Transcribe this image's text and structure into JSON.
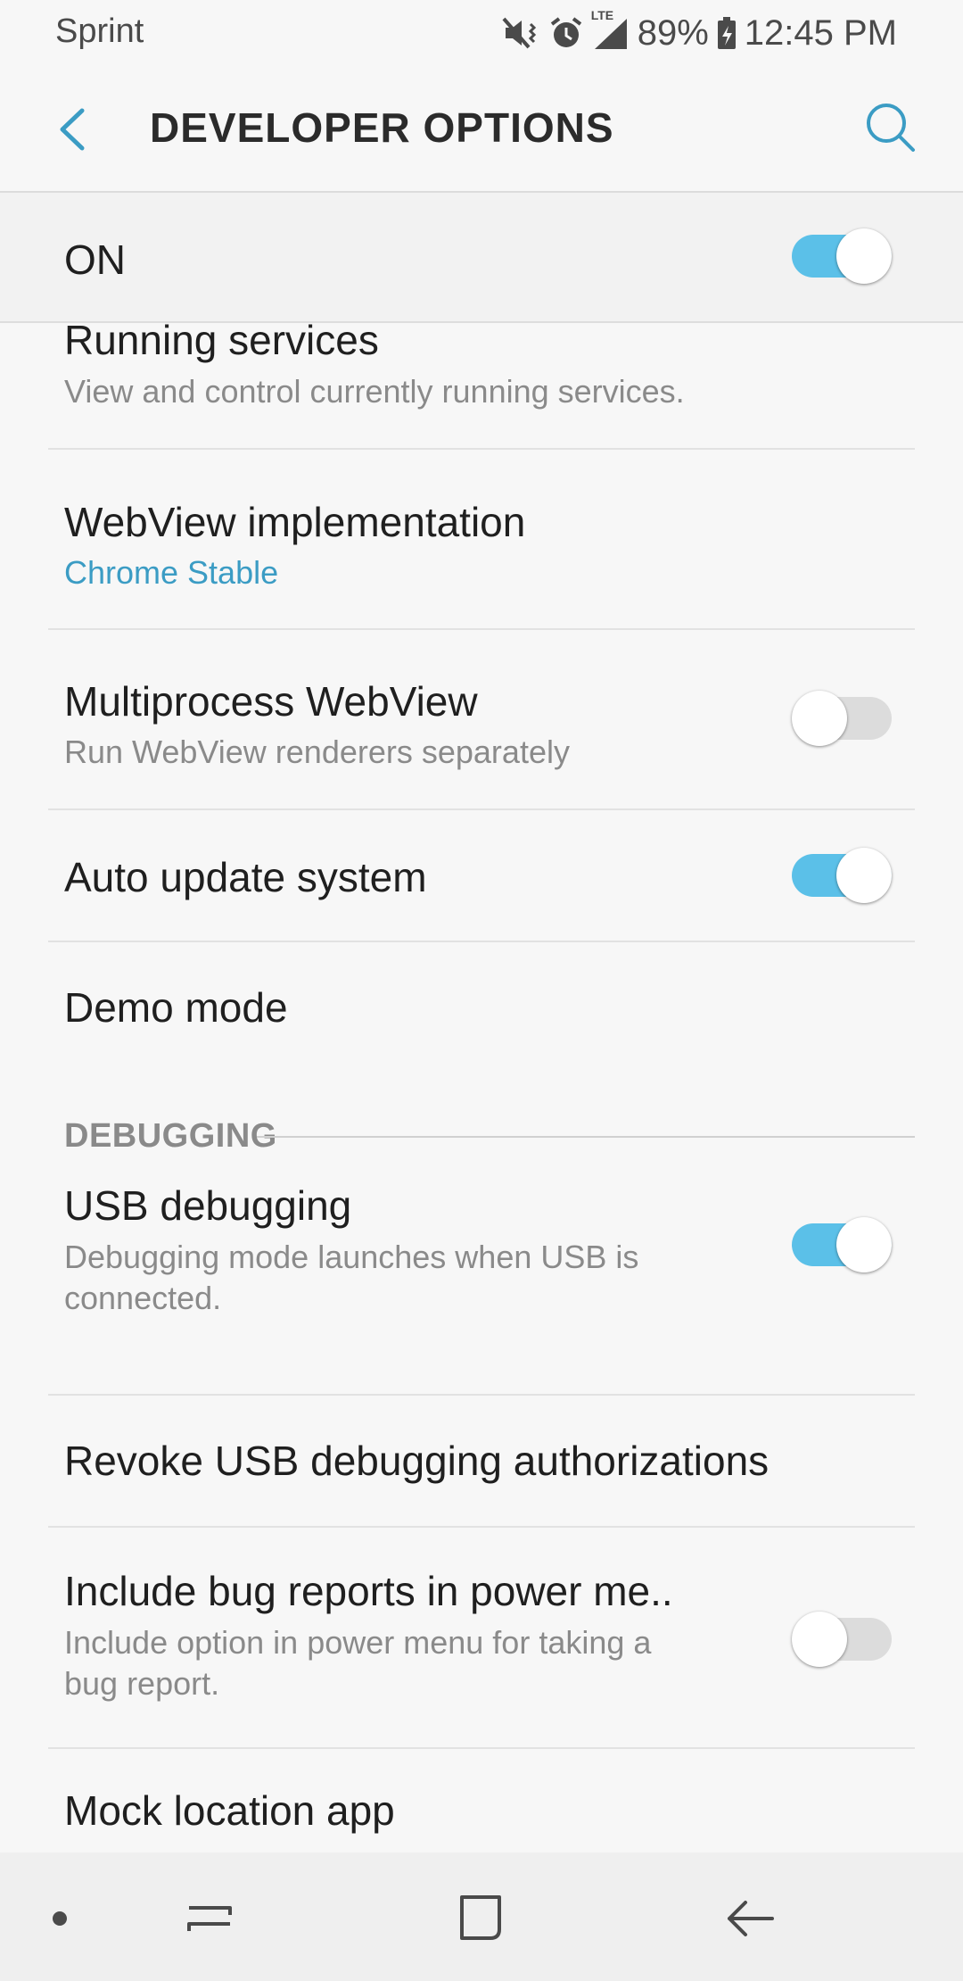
{
  "status_bar": {
    "carrier": "Sprint",
    "battery": "89%",
    "time": "12:45 PM",
    "network_label": "LTE",
    "icons": [
      "mute-vibrate-icon",
      "alarm-icon",
      "signal-icon",
      "battery-charging-icon"
    ]
  },
  "appbar": {
    "title": "DEVELOPER OPTIONS",
    "back_icon": "back-arrow-icon",
    "search_icon": "search-icon"
  },
  "master_switch": {
    "label": "ON",
    "on": true
  },
  "items": [
    {
      "title": "Running services",
      "subtitle": "View and control currently running services."
    },
    {
      "title": "WebView implementation",
      "subtitle": "Chrome Stable"
    },
    {
      "title": "Multiprocess WebView",
      "subtitle": "Run WebView renderers separately",
      "toggle": false
    },
    {
      "title": "Auto update system",
      "toggle": true
    },
    {
      "title": "Demo mode"
    }
  ],
  "debugging": {
    "header": "DEBUGGING",
    "items": [
      {
        "title": "USB debugging",
        "subtitle_line1": "Debugging mode launches when USB is",
        "subtitle_line2": "connected.",
        "toggle": true
      },
      {
        "title": "Revoke USB debugging authorizations"
      },
      {
        "title": "Include bug reports in power me..",
        "subtitle_line1": "Include option in power menu for taking a",
        "subtitle_line2": "bug report.",
        "toggle": false
      },
      {
        "title": "Mock location app"
      }
    ]
  },
  "navbar": {
    "icons": [
      "dot-icon",
      "recents-icon",
      "home-icon",
      "back-icon"
    ]
  },
  "colors": {
    "accent": "#5bc0e8",
    "accent_text": "#3b9cc4",
    "toggle_off": "#dcdcdc"
  }
}
